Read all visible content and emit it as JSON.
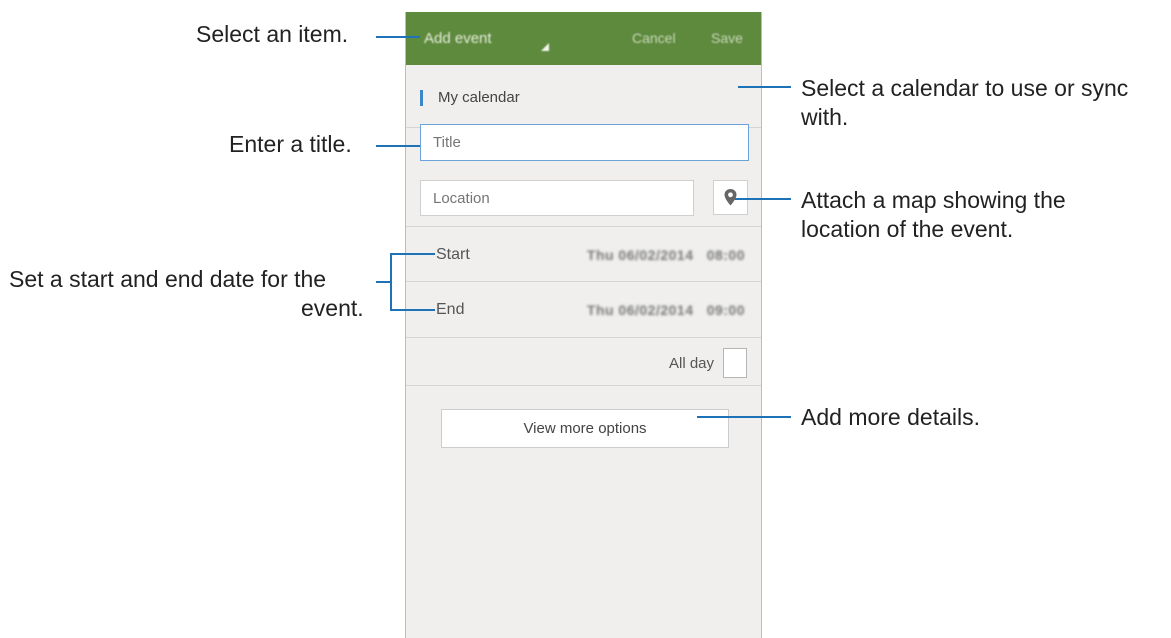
{
  "screen": {
    "action_bar": {
      "title": "Add event",
      "cancel_label": "Cancel",
      "save_label": "Save"
    },
    "calendar_label": "My calendar",
    "title_placeholder": "Title",
    "location_placeholder": "Location",
    "start": {
      "label": "Start",
      "date": "Thu 06/02/2014",
      "time": "08:00"
    },
    "end": {
      "label": "End",
      "date": "Thu 06/02/2014",
      "time": "09:00"
    },
    "all_day_label": "All day",
    "all_day_checked": false,
    "more_options_label": "View more options"
  },
  "callouts": {
    "select_item": "Select an item.",
    "enter_title": "Enter a title.",
    "set_dates_line1": "Set a start and end date for the",
    "set_dates_line2": "event.",
    "calendar_line1": "Select a calendar to use or sync",
    "calendar_line2": "with.",
    "map_line1": "Attach a map showing the",
    "map_line2": "location of the event.",
    "more_details": "Add more details."
  },
  "colors": {
    "action_bar": "#5e8a3e",
    "accent_blue": "#3d86c8",
    "callout_line": "#1e73b8",
    "screen_bg": "#f0efee"
  },
  "icons": {
    "location": "map-pin-icon",
    "spinner": "dropdown-triangle-icon"
  }
}
